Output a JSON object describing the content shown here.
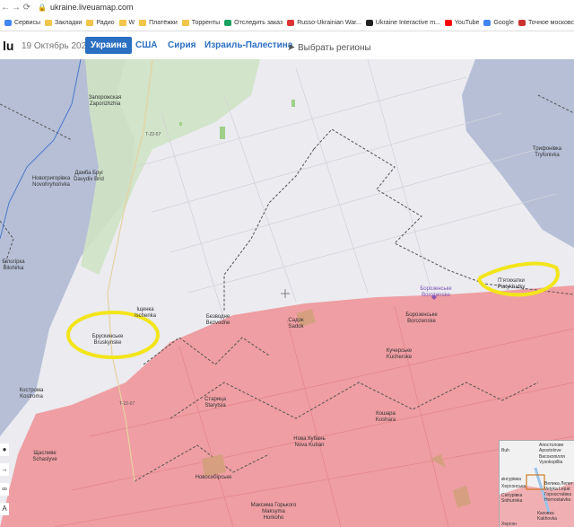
{
  "browser": {
    "url": "ukraine.liveuamap.com",
    "bookmarks": [
      {
        "label": "Сервисы",
        "icon": "apps-icon"
      },
      {
        "label": "Закладки",
        "icon": "folder-icon"
      },
      {
        "label": "Радио",
        "icon": "folder-icon"
      },
      {
        "label": "W",
        "icon": "folder-icon"
      },
      {
        "label": "Платёжки",
        "icon": "folder-icon"
      },
      {
        "label": "Торренты",
        "icon": "folder-icon"
      },
      {
        "label": "Отследить заказ",
        "icon": "tracking-icon"
      },
      {
        "label": "Russo-Ukrainian War...",
        "icon": "map-pin-icon"
      },
      {
        "label": "Ukraine Interactive m...",
        "icon": "liveuamap-icon"
      },
      {
        "label": "YouTube",
        "icon": "youtube-icon"
      },
      {
        "label": "Google",
        "icon": "google-icon"
      },
      {
        "label": "Точное московское...",
        "icon": "clock-icon"
      }
    ]
  },
  "toolbar": {
    "date": "19 Октябрь 2022",
    "tabs": [
      {
        "label": "Украина",
        "active": true
      },
      {
        "label": "США",
        "active": false
      },
      {
        "label": "Сирия",
        "active": false
      },
      {
        "label": "Израиль-Палестина",
        "active": false
      }
    ],
    "regions_label": "Выбрать регионы"
  },
  "map": {
    "places": [
      {
        "name": "Запорожская\nZaporizhzhia"
      },
      {
        "name": "Дамба Бруі\nDavydiv Brid"
      },
      {
        "name": "Новогригорівка\nNovohryhorivka"
      },
      {
        "name": "Білогірка\nBilohirka"
      },
      {
        "name": "Брускинське\nBruskynske"
      },
      {
        "name": "Іщенка\nIschenka"
      },
      {
        "name": "Безводне\nBezvodne"
      },
      {
        "name": "Садок\nSadok"
      },
      {
        "name": "Борозенське\nBorozenske"
      },
      {
        "name": "Борозенське\nBorozenske"
      },
      {
        "name": "П'ятихатки\nPiatykhatky"
      },
      {
        "name": "Трифонівка\nTryfonivka"
      },
      {
        "name": "Кучерське\nKucherske"
      },
      {
        "name": "Кострома\nKostroma"
      },
      {
        "name": "Старица\nStarytsia"
      },
      {
        "name": "Кошара\nKoshara"
      },
      {
        "name": "Нова Кубань\nNova Kuban"
      },
      {
        "name": "Щасливе\nSchaslyve"
      },
      {
        "name": "Новосибірське"
      },
      {
        "name": "Максима Горького\nMaksyma\nHorkoho"
      }
    ],
    "roads": [
      "T-22-07",
      "T-22-07"
    ],
    "colors": {
      "ukraine": "#e8e8ee",
      "occupied": "#ee9a9f",
      "blue": "#b4bdd3",
      "highlight": "#f5ea1a"
    },
    "sidebar_icons": [
      "share-icon",
      "arrow-icon",
      "link-icon",
      "font-icon"
    ],
    "minimap": {
      "labels": [
        "Апостолове",
        "Apostolove",
        "Високопілля",
        "Vysokopillia",
        "Велика Лепет",
        "Velyka Lepat",
        "Горностаївка",
        "Hornostaivka",
        "Снігурівка",
        "Snihurivka",
        "Каховка",
        "Kakhovka",
        "Херсон",
        "Херсонська",
        "кінгурівка",
        "Buh"
      ]
    }
  }
}
